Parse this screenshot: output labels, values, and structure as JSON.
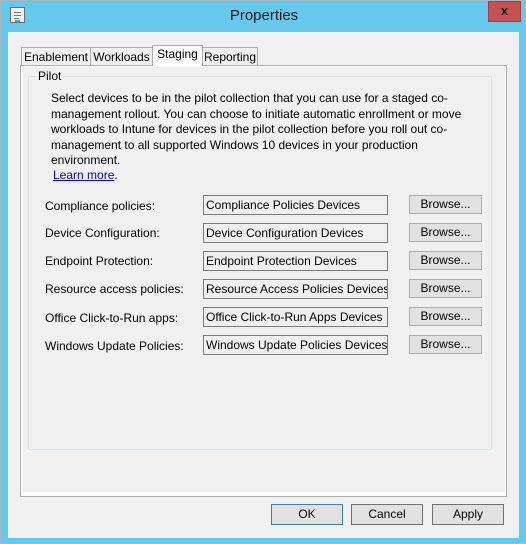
{
  "window": {
    "title": "Properties",
    "close_label": "x",
    "colors": {
      "frame": "#64c9eb",
      "close": "#c75050",
      "link": "#0000ee"
    }
  },
  "tabs": [
    {
      "label": "Enablement",
      "active": false
    },
    {
      "label": "Workloads",
      "active": false
    },
    {
      "label": "Staging",
      "active": true
    },
    {
      "label": "Reporting",
      "active": false
    }
  ],
  "pilot": {
    "group_label": "Pilot",
    "description": "Select devices to be in the pilot collection that you can use for a staged co-management rollout. You can choose to initiate automatic enrollment or move workloads to Intune for devices in the pilot collection before you roll out co-management to all supported Windows 10 devices in your production environment.",
    "learn_more": "Learn more",
    "learn_more_suffix": ".",
    "rows": [
      {
        "label": "Compliance policies:",
        "value": "Compliance Policies Devices",
        "button": "Browse..."
      },
      {
        "label": "Device Configuration:",
        "value": "Device Configuration Devices",
        "button": "Browse..."
      },
      {
        "label": "Endpoint Protection:",
        "value": "Endpoint Protection Devices",
        "button": "Browse..."
      },
      {
        "label": "Resource access policies:",
        "value": "Resource Access Policies Devices",
        "button": "Browse..."
      },
      {
        "label": "Office Click-to-Run apps:",
        "value": "Office Click-to-Run Apps Devices",
        "button": "Browse..."
      },
      {
        "label": "Windows Update Policies:",
        "value": "Windows Update Policies Devices",
        "button": "Browse..."
      }
    ]
  },
  "buttons": {
    "ok": "OK",
    "cancel": "Cancel",
    "apply": "Apply"
  }
}
